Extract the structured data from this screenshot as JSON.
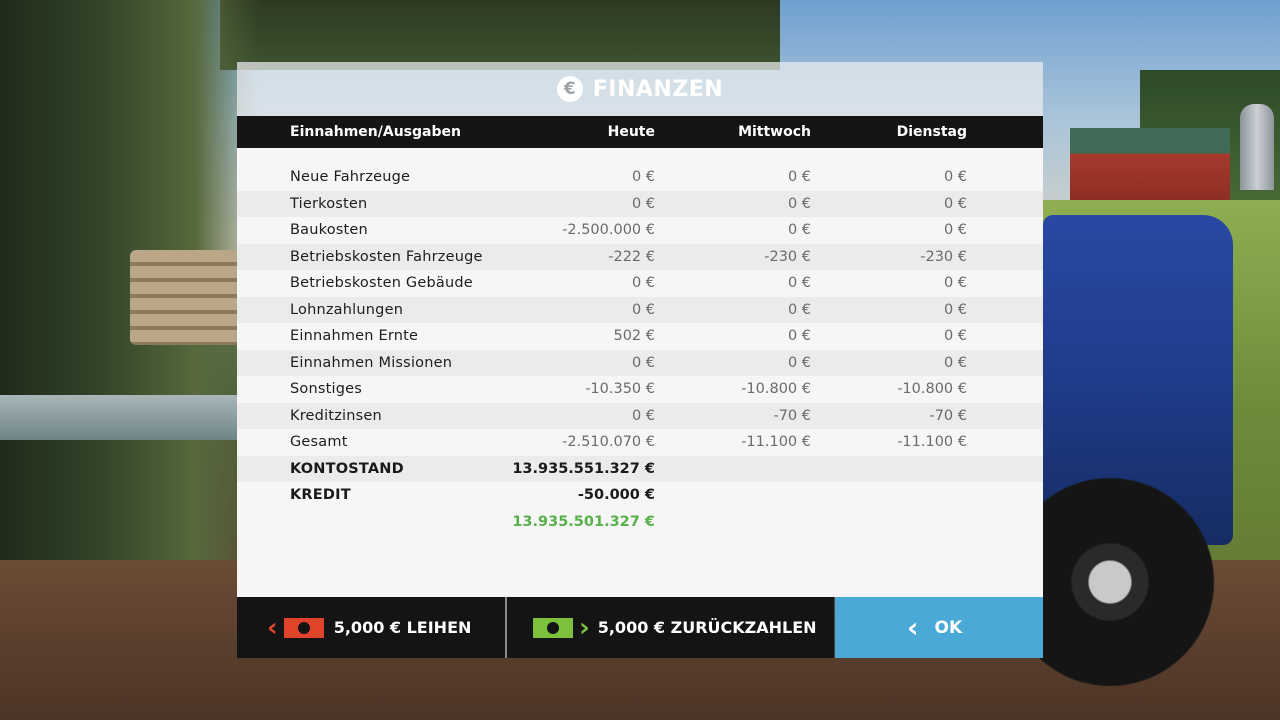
{
  "dialog": {
    "title": "FINANZEN",
    "title_icon": "€"
  },
  "table": {
    "headers": [
      "Einnahmen/Ausgaben",
      "Heute",
      "Mittwoch",
      "Dienstag"
    ],
    "rows": [
      {
        "label": "Neue Fahrzeuge",
        "today": "0 €",
        "wed": "0 €",
        "tue": "0 €"
      },
      {
        "label": "Tierkosten",
        "today": "0 €",
        "wed": "0 €",
        "tue": "0 €"
      },
      {
        "label": "Baukosten",
        "today": "-2.500.000 €",
        "wed": "0 €",
        "tue": "0 €"
      },
      {
        "label": "Betriebskosten Fahrzeuge",
        "today": "-222 €",
        "wed": "-230 €",
        "tue": "-230 €"
      },
      {
        "label": "Betriebskosten Gebäude",
        "today": "0 €",
        "wed": "0 €",
        "tue": "0 €"
      },
      {
        "label": "Lohnzahlungen",
        "today": "0 €",
        "wed": "0 €",
        "tue": "0 €"
      },
      {
        "label": "Einnahmen Ernte",
        "today": "502 €",
        "wed": "0 €",
        "tue": "0 €"
      },
      {
        "label": "Einnahmen Missionen",
        "today": "0 €",
        "wed": "0 €",
        "tue": "0 €"
      },
      {
        "label": "Sonstiges",
        "today": "-10.350 €",
        "wed": "-10.800 €",
        "tue": "-10.800 €"
      },
      {
        "label": "Kreditzinsen",
        "today": "0 €",
        "wed": "-70 €",
        "tue": "-70 €"
      },
      {
        "label": "Gesamt",
        "today": "-2.510.070 €",
        "wed": "-11.100 €",
        "tue": "-11.100 €"
      }
    ],
    "kontostand": {
      "label": "KONTOSTAND",
      "value": "13.935.551.327 €"
    },
    "kredit": {
      "label": "KREDIT",
      "value": "-50.000 €"
    },
    "net_total": "13.935.501.327 €"
  },
  "footer": {
    "borrow_label": "5,000 € LEIHEN",
    "repay_label": "5,000 € ZURÜCKZAHLEN",
    "ok_label": "OK"
  },
  "colors": {
    "header_bg": "#151515",
    "ok_button": "#4aa9d6",
    "borrow_accent": "#e0452a",
    "repay_accent": "#7cc23d",
    "net_total": "#58b04b"
  }
}
